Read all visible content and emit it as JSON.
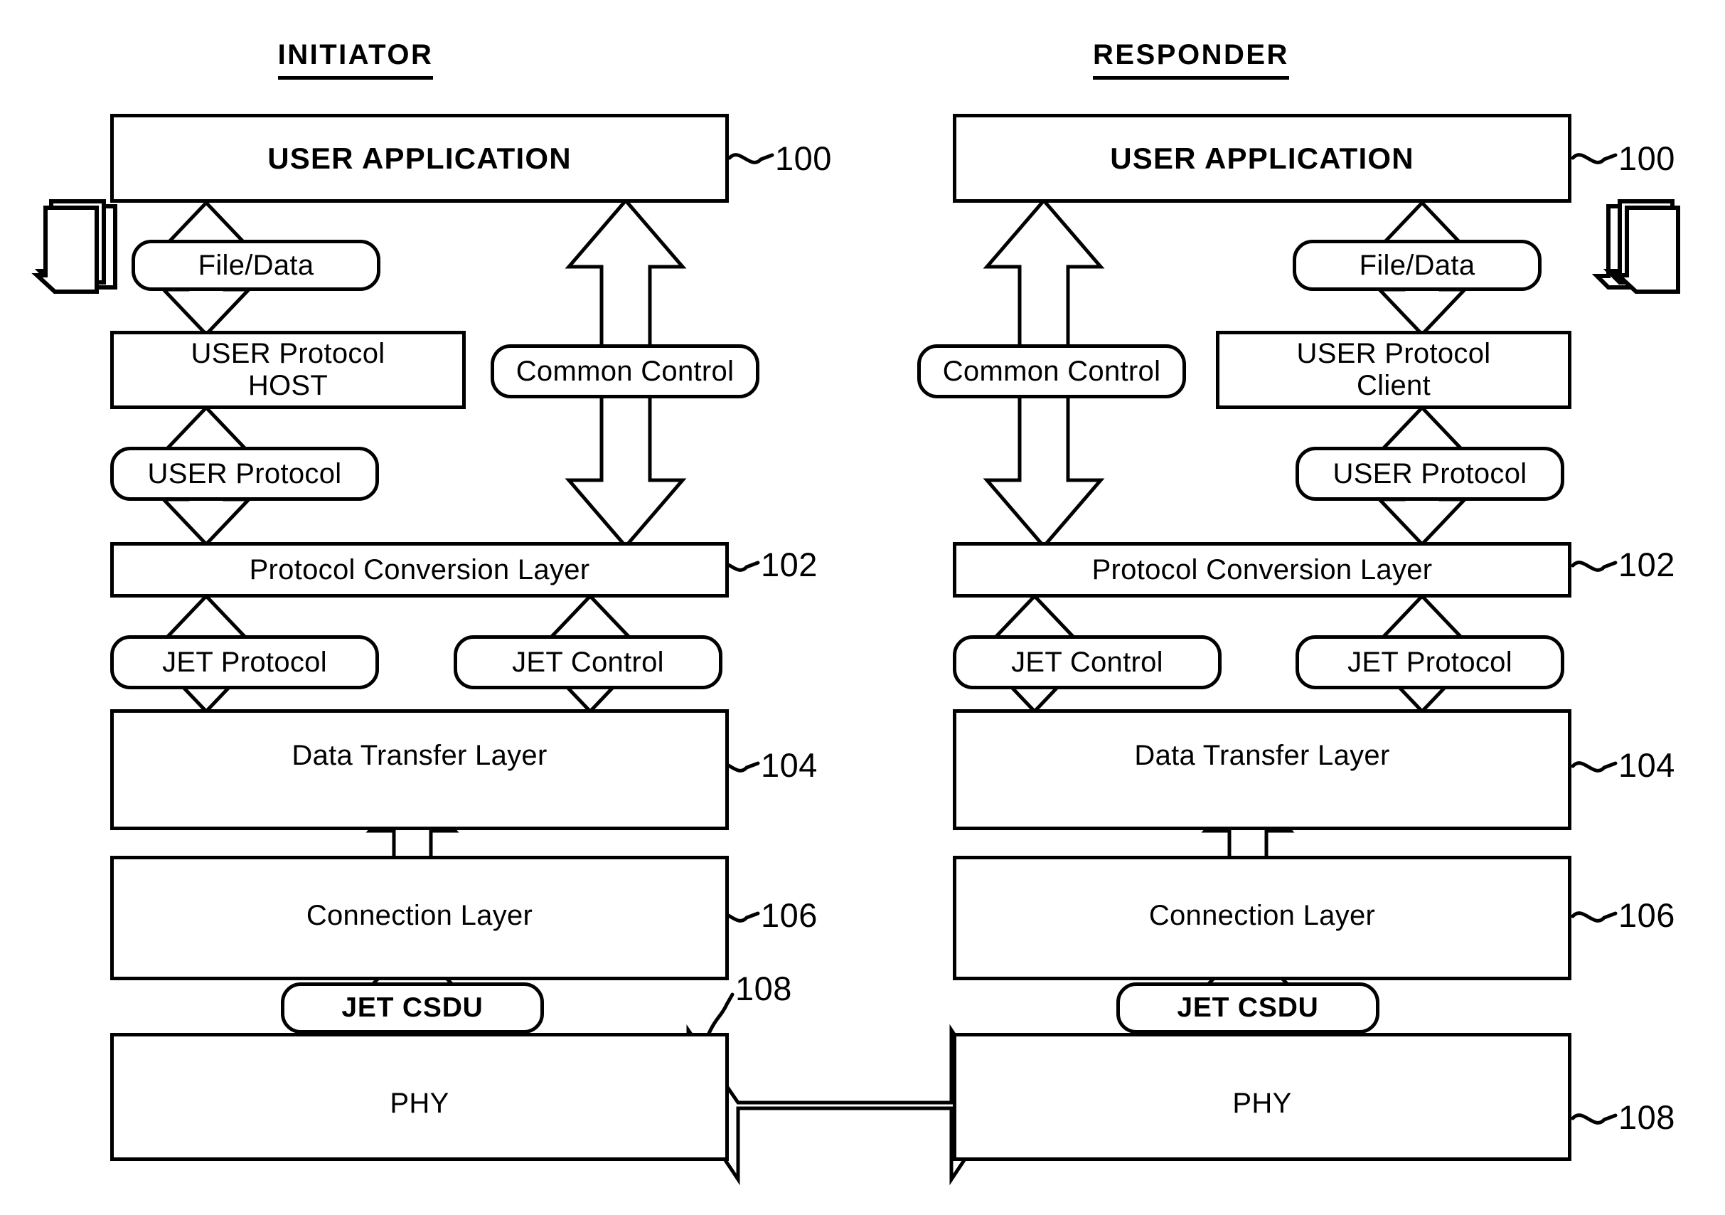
{
  "figure": {
    "type": "patent-block-diagram",
    "columns": [
      {
        "id": "initiator",
        "title": "INITIATOR"
      },
      {
        "id": "responder",
        "title": "RESPONDER"
      }
    ],
    "reference_numerals": {
      "user_application": "100",
      "protocol_conversion_layer": "102",
      "data_transfer_layer": "104",
      "connection_layer": "106",
      "phy": "108"
    },
    "initiator": {
      "user_application": "USER APPLICATION",
      "file_data": "File/Data",
      "user_protocol_host_line1": "USER Protocol",
      "user_protocol_host_line2": "HOST",
      "common_control": "Common Control",
      "user_protocol": "USER Protocol",
      "protocol_conversion_layer": "Protocol Conversion Layer",
      "jet_protocol": "JET Protocol",
      "jet_control": "JET Control",
      "data_transfer_layer": "Data Transfer Layer",
      "connection_layer": "Connection Layer",
      "jet_csdu": "JET CSDU",
      "phy": "PHY",
      "ref_100": "100",
      "ref_102": "102",
      "ref_104": "104",
      "ref_106": "106",
      "ref_108": "108"
    },
    "responder": {
      "user_application": "USER APPLICATION",
      "file_data": "File/Data",
      "user_protocol_client_line1": "USER Protocol",
      "user_protocol_client_line2": "Client",
      "common_control": "Common Control",
      "user_protocol": "USER Protocol",
      "protocol_conversion_layer": "Protocol Conversion Layer",
      "jet_control": "JET Control",
      "jet_protocol": "JET Protocol",
      "data_transfer_layer": "Data Transfer Layer",
      "connection_layer": "Connection Layer",
      "jet_csdu": "JET CSDU",
      "phy": "PHY",
      "ref_100": "100",
      "ref_102": "102",
      "ref_104": "104",
      "ref_106": "106",
      "ref_108": "108"
    },
    "icons": {
      "document_stack": "document-stack-icon",
      "link_arrow": "phy-link-double-arrow"
    },
    "colors": {
      "ink": "#000000",
      "paper": "#ffffff"
    }
  }
}
